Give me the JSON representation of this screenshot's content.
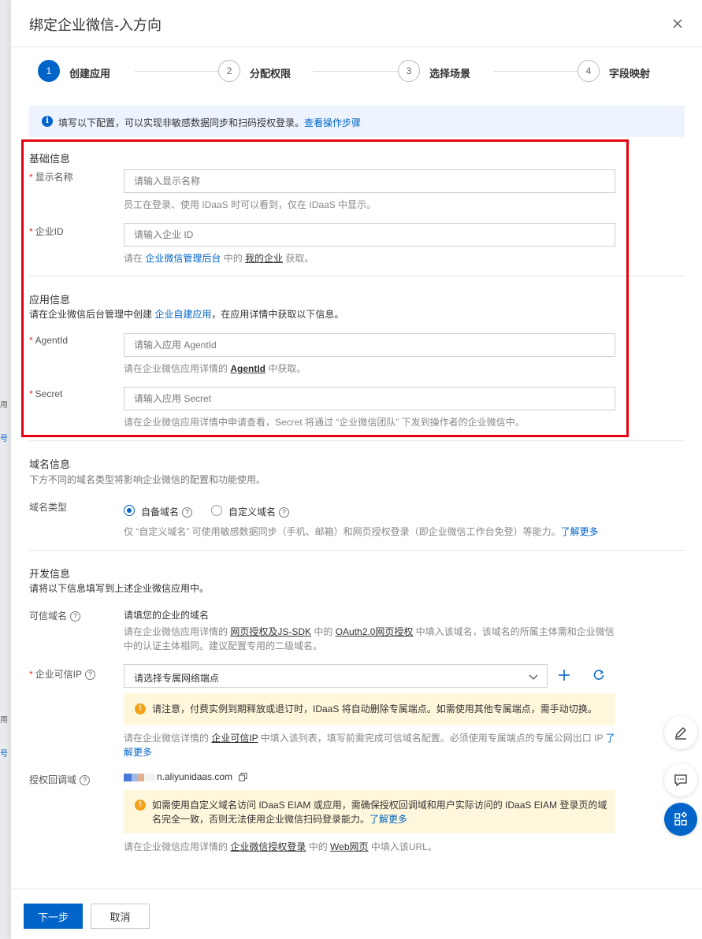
{
  "backdrop": {
    "frag1": "用",
    "frag2": "号",
    "frag3": "用",
    "frag4": "号"
  },
  "dialog": {
    "title": "绑定企业微信-入方向"
  },
  "steps": [
    {
      "num": "1",
      "label": "创建应用"
    },
    {
      "num": "2",
      "label": "分配权限"
    },
    {
      "num": "3",
      "label": "选择场景"
    },
    {
      "num": "4",
      "label": "字段映射"
    }
  ],
  "banner": {
    "text": "填写以下配置，可以实现非敏感数据同步和扫码授权登录。",
    "link": "查看操作步骤"
  },
  "basic": {
    "title": "基础信息",
    "display_name": {
      "label": "显示名称",
      "placeholder": "请输入显示名称",
      "hint": "员工在登录、使用 IDaaS 时可以看到，仅在 IDaaS 中显示。"
    },
    "corp_id": {
      "label": "企业ID",
      "placeholder": "请输入企业 ID",
      "hint_pre": "请在 ",
      "hint_link": "企业微信管理后台",
      "hint_mid": " 中的 ",
      "hint_link2": "我的企业",
      "hint_post": " 获取。"
    }
  },
  "app": {
    "title": "应用信息",
    "desc_pre": "请在企业微信后台管理中创建 ",
    "desc_link": "企业自建应用",
    "desc_post": "，在应用详情中获取以下信息。",
    "agent_id": {
      "label": "AgentId",
      "placeholder": "请输入应用 AgentId",
      "hint_pre": "请在企业微信应用详情的 ",
      "hint_link": "AgentId",
      "hint_post": " 中获取。"
    },
    "secret": {
      "label": "Secret",
      "placeholder": "请输入应用 Secret",
      "hint": "请在企业微信应用详情中申请查看，Secret 将通过 “企业微信团队” 下发到操作者的企业微信中。"
    }
  },
  "domain": {
    "title": "域名信息",
    "desc": "下方不同的域名类型将影响企业微信的配置和功能使用。",
    "type_label": "域名类型",
    "options": [
      "自备域名",
      "自定义域名"
    ],
    "selected": "自备域名",
    "hint_pre": "仅 “自定义域名” 可使用敏感数据同步（手机、邮箱）和网页授权登录（即企业微信工作台免登）等能力。",
    "hint_link": "了解更多"
  },
  "dev": {
    "title": "开发信息",
    "desc": "请将以下信息填写到上述企业微信应用中。",
    "trusted_domain": {
      "label": "可信域名",
      "value": "请填您的企业的域名",
      "hint_pre": "请在企业微信应用详情的 ",
      "hint_link1": "网页授权及JS-SDK",
      "hint_mid": " 中的 ",
      "hint_link2": "OAuth2.0网页授权",
      "hint_post1": " 中填入该域名，该域名的所属主体需和企业微信",
      "hint_post2": "中的认证主体相同。建议配置专用的二级域名。"
    },
    "trusted_ip": {
      "label": "企业可信IP",
      "select_value": "请选择专属网络端点",
      "warning": "请注意，付费实例到期释放或退订时，IDaaS 将自动删除专属端点。如需使用其他专属端点，需手动切换。",
      "hint_pre": "请在企业微信详情的 ",
      "hint_link": "企业可信IP",
      "hint_post": " 中填入该列表，填写前需完成可信域名配置。必须使用专属端点的专属公网出口 IP ",
      "hint_more1": "了",
      "hint_more2": "解更多"
    },
    "callback": {
      "label": "授权回调域",
      "url_visible": "n.aliyunidaas.com",
      "warning_line1": "如需使用自定义域名访问 IDaaS EIAM 或应用，需确保授权回调域和用户实际访问的 IDaaS EIAM 登录页的域",
      "warning_line2": "名完全一致，否则无法使用企业微信扫码登录能力。",
      "warning_link": "了解更多",
      "hint_pre": "请在企业微信应用详情的 ",
      "hint_link1": "企业微信授权登录",
      "hint_mid": " 中的 ",
      "hint_link2": "Web网页",
      "hint_post": " 中填入该URL。"
    }
  },
  "footer": {
    "next": "下一步",
    "cancel": "取消"
  },
  "icons": {
    "close": "close-icon",
    "info": "info-icon",
    "help": "question-icon",
    "caret": "chevron-down-icon",
    "add": "plus-icon",
    "refresh": "refresh-icon",
    "copy": "copy-icon",
    "edit": "edit-icon",
    "feedback": "chat-icon",
    "apps": "apps-icon"
  },
  "colors": {
    "primary": "#0064c8",
    "highlight": "#e60012",
    "warning_bg": "#fff7db",
    "info_bg": "#edf4ff"
  }
}
